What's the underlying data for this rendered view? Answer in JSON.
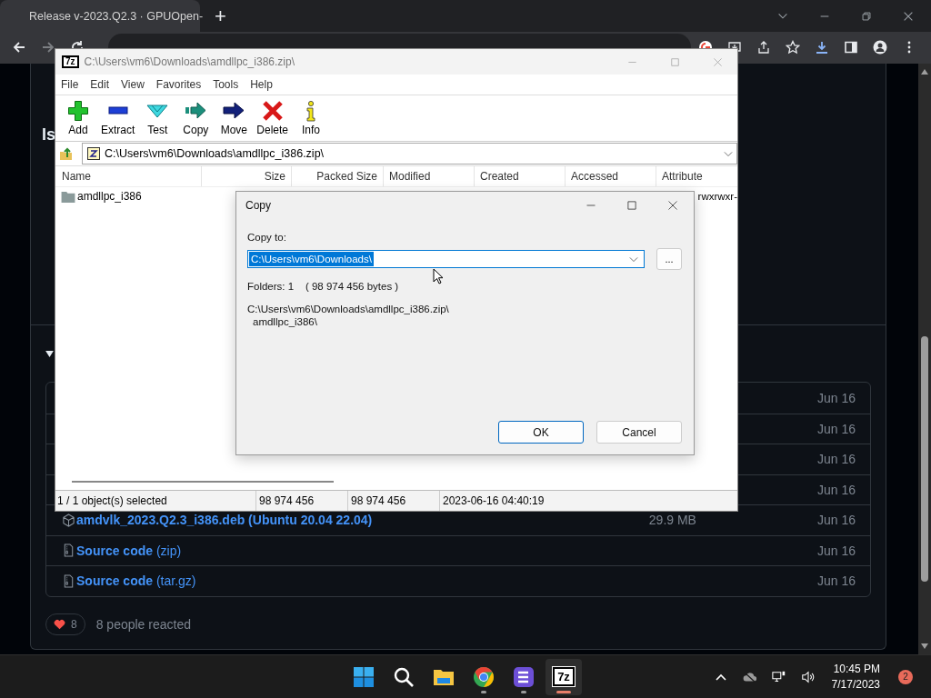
{
  "browser": {
    "tab_title": "Release v-2023.Q2.3 · GPUOpen-",
    "new_tab": "+"
  },
  "page": {
    "heading": "Is",
    "assets": [
      {
        "kind": "hidden",
        "date": "Jun 16"
      },
      {
        "kind": "hidden",
        "date": "Jun 16"
      },
      {
        "kind": "hidden",
        "date": "Jun 16"
      },
      {
        "kind": "hidden",
        "date": "Jun 16"
      },
      {
        "kind": "package",
        "name": "amdvlk_2023.Q2.3_i386.deb (Ubuntu 20.04 22.04)",
        "size": "29.9 MB",
        "date": "Jun 16"
      },
      {
        "kind": "source",
        "name": "**Source code** (zip)",
        "date": "Jun 16"
      },
      {
        "kind": "source",
        "name": "**Source code** (tar.gz)",
        "date": "Jun 16"
      }
    ],
    "reaction_count": "8",
    "reaction_summary": "8 people reacted"
  },
  "archiver": {
    "logo": "7z",
    "title": "C:\\Users\\vm6\\Downloads\\amdllpc_i386.zip\\",
    "menu": [
      "File",
      "Edit",
      "View",
      "Favorites",
      "Tools",
      "Help"
    ],
    "toolbar": [
      {
        "kind": "add",
        "label": "Add"
      },
      {
        "kind": "extract",
        "label": "Extract"
      },
      {
        "kind": "test",
        "label": "Test"
      },
      {
        "kind": "copy",
        "label": "Copy"
      },
      {
        "kind": "move",
        "label": "Move"
      },
      {
        "kind": "delete",
        "label": "Delete"
      },
      {
        "kind": "info",
        "label": "Info"
      }
    ],
    "path": "C:\\Users\\vm6\\Downloads\\amdllpc_i386.zip\\",
    "columns": [
      {
        "label": "Name",
        "numeric": false
      },
      {
        "label": "Size",
        "numeric": true
      },
      {
        "label": "Packed Size",
        "numeric": true
      },
      {
        "label": "Modified",
        "numeric": false
      },
      {
        "label": "Created",
        "numeric": false
      },
      {
        "label": "Accessed",
        "numeric": false
      },
      {
        "label": "Attribute",
        "numeric": false
      }
    ],
    "rows": [
      {
        "name": "amdllpc_i386",
        "attributes": "rwxrwxr-"
      }
    ],
    "status": [
      "1 / 1 object(s) selected",
      "98 974 456",
      "98 974 456",
      "2023-06-16 04:40:19"
    ]
  },
  "dialog": {
    "title": "Copy",
    "label": "Copy to:",
    "destination": "C:\\Users\\vm6\\Downloads\\",
    "destination_selected": true,
    "browse": "...",
    "info": "Folders: 1    ( 98 974 456 bytes )",
    "source_lines": [
      "C:\\Users\\vm6\\Downloads\\amdllpc_i386.zip\\",
      "amdllpc_i386\\"
    ],
    "buttons": [
      {
        "label": "OK",
        "default": true
      },
      {
        "label": "Cancel",
        "default": false
      }
    ]
  },
  "taskbar": {
    "apps": [
      {
        "kind": "start",
        "running": false,
        "active": false
      },
      {
        "kind": "search",
        "running": false,
        "active": false
      },
      {
        "kind": "explorer",
        "running": false,
        "active": false
      },
      {
        "kind": "chrome",
        "running": true,
        "active": false
      },
      {
        "kind": "app",
        "running": true,
        "active": false
      },
      {
        "kind": "archiver",
        "label": "7z",
        "running": true,
        "active": true
      }
    ],
    "time": "10:45 PM",
    "date": "7/17/2023",
    "notifications": "2"
  }
}
